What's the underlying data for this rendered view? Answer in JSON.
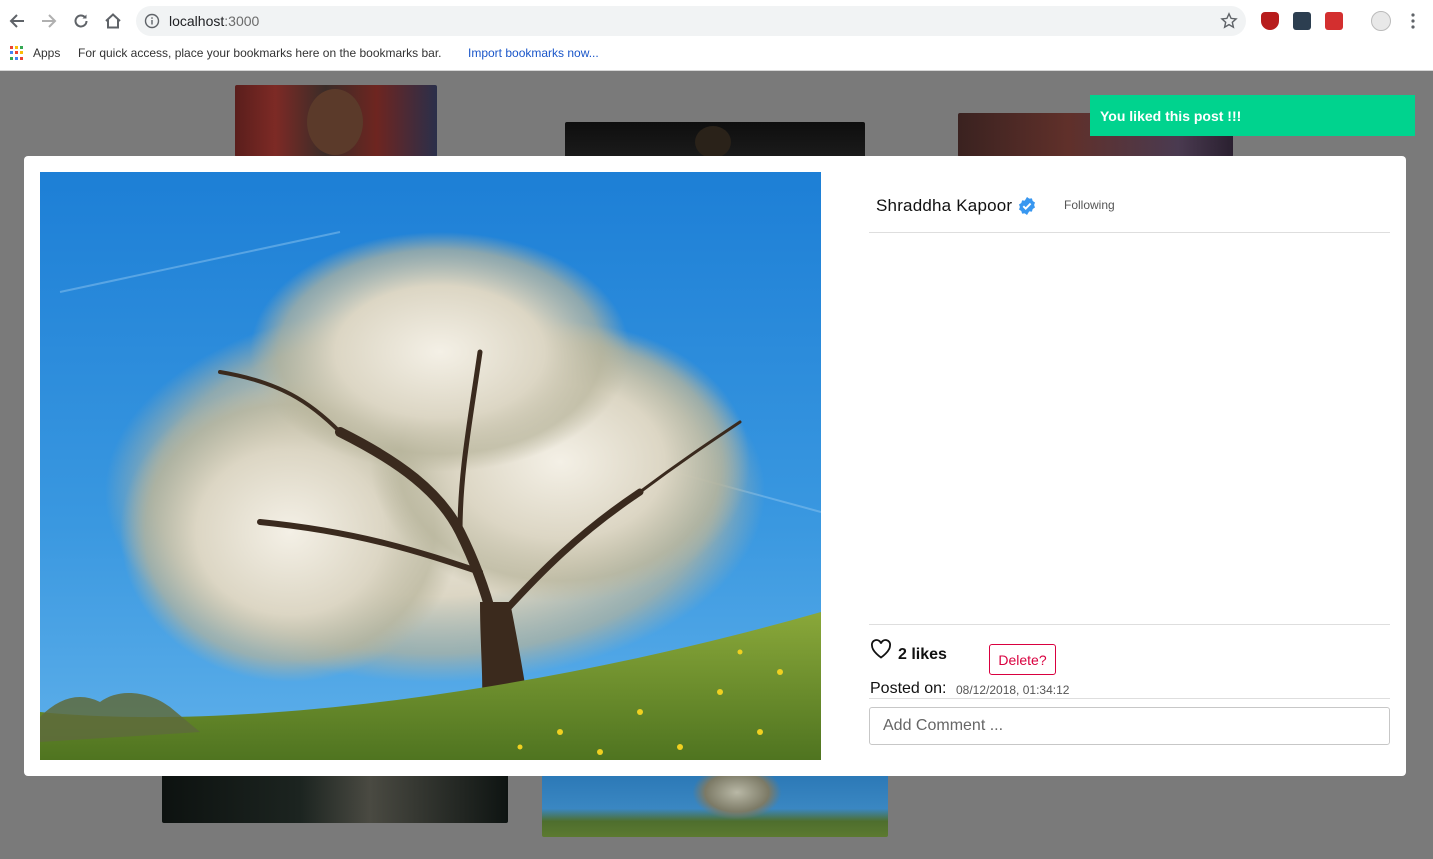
{
  "browser": {
    "url_host": "localhost",
    "url_port": ":3000",
    "bookmarks_apps_label": "Apps",
    "bookmarks_message": "For quick access, place your bookmarks here on the bookmarks bar.",
    "bookmarks_import_link": "Import bookmarks now..."
  },
  "toast": {
    "message": "You liked this post !!!",
    "color": "#00d38e"
  },
  "post": {
    "username": "Shraddha Kapoor",
    "follow_status": "Following",
    "likes_text": "2 likes",
    "delete_label": "Delete?",
    "posted_label": "Posted on:",
    "posted_date": "08/12/2018, 01:34:12",
    "comment_placeholder": "Add Comment ..."
  },
  "icons": [
    "back-arrow-icon",
    "forward-arrow-icon",
    "reload-icon",
    "home-icon",
    "info-icon",
    "star-icon",
    "apps-grid-icon",
    "verified-badge-icon",
    "heart-icon",
    "menu-dots-icon"
  ],
  "colors": {
    "accent_verified": "#3897f0",
    "danger": "#d9003f",
    "success": "#00d38e"
  }
}
